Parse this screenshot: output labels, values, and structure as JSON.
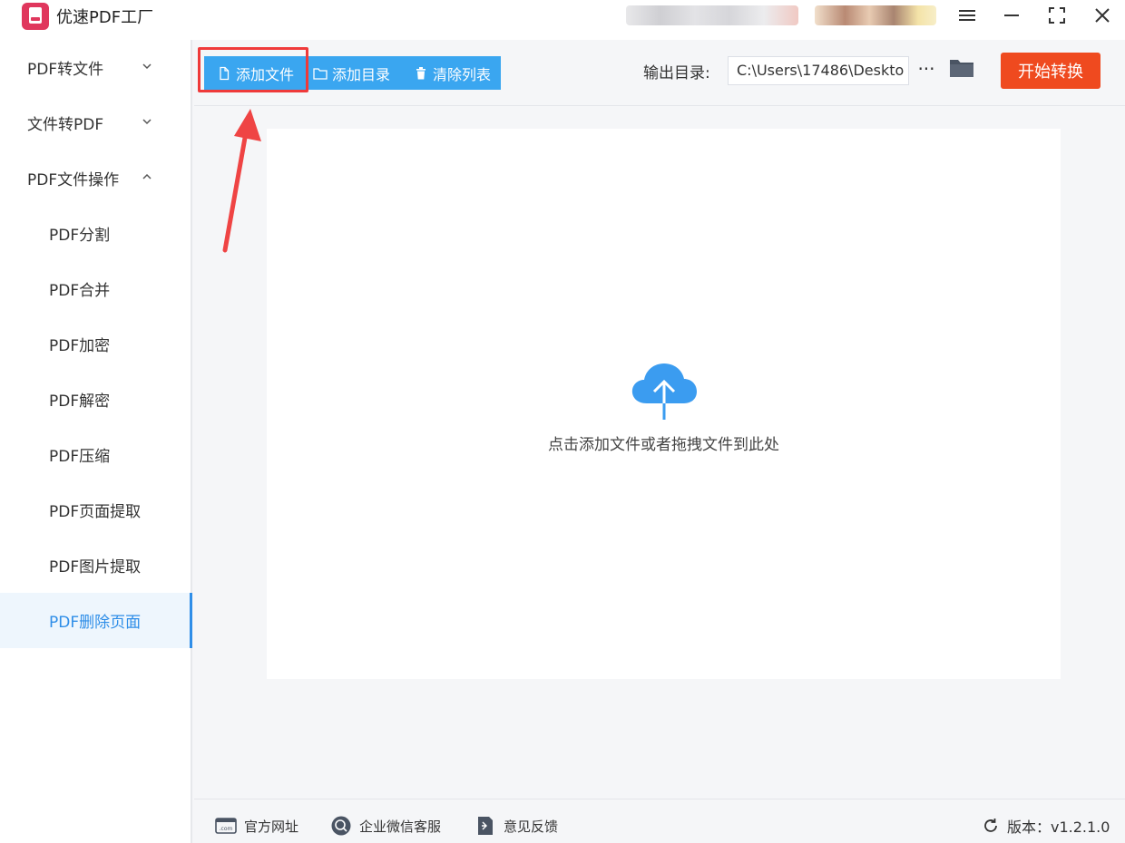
{
  "app": {
    "title": "优速PDF工厂",
    "accent_color": "#3aa6f0",
    "danger_color": "#ef4a1f",
    "window_controls": [
      "menu-icon",
      "minimize-icon",
      "maximize-icon",
      "close-icon"
    ]
  },
  "sidebar": {
    "groups": [
      {
        "label": "PDF转文件",
        "expanded": false
      },
      {
        "label": "文件转PDF",
        "expanded": false
      },
      {
        "label": "PDF文件操作",
        "expanded": true
      }
    ],
    "items": [
      {
        "label": "PDF分割"
      },
      {
        "label": "PDF合并"
      },
      {
        "label": "PDF加密"
      },
      {
        "label": "PDF解密"
      },
      {
        "label": "PDF压缩"
      },
      {
        "label": "PDF页面提取"
      },
      {
        "label": "PDF图片提取"
      },
      {
        "label": "PDF删除页面",
        "active": true
      }
    ]
  },
  "toolbar": {
    "add_file": "添加文件",
    "add_folder": "添加目录",
    "clear_list": "清除列表",
    "output_label": "输出目录:",
    "output_path": "C:\\Users\\17486\\Deskto",
    "more_label": "···",
    "start_label": "开始转换"
  },
  "dropzone": {
    "hint": "点击添加文件或者拖拽文件到此处",
    "icon": "cloud-upload-icon"
  },
  "footer": {
    "website": "官方网址",
    "wechat_support": "企业微信客服",
    "feedback": "意见反馈",
    "version": "版本：v1.2.1.0"
  }
}
